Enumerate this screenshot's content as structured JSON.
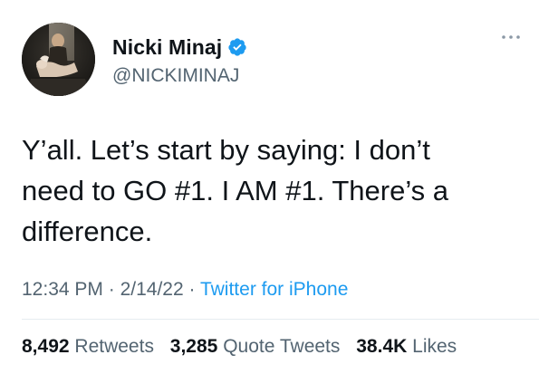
{
  "author": {
    "display_name": "Nicki Minaj",
    "handle": "@NICKIMINAJ",
    "verified": true,
    "verified_color": "#1d9bf0"
  },
  "tweet": {
    "text": "Y’all. Let’s start by saying: I don’t\nneed to GO #1. I AM #1. There’s a\ndifference.",
    "time": "12:34 PM",
    "date": "2/14/22",
    "source": "Twitter for iPhone",
    "separator": "·"
  },
  "stats": {
    "retweets_count": "8,492",
    "retweets_label": "Retweets",
    "quotes_count": "3,285",
    "quotes_label": "Quote Tweets",
    "likes_count": "38.4K",
    "likes_label": "Likes"
  },
  "icons": {
    "more": "more-dots-icon",
    "verified": "verified-badge-icon"
  },
  "colors": {
    "text_primary": "#0f1419",
    "text_secondary": "#536471",
    "link": "#1d9bf0"
  }
}
